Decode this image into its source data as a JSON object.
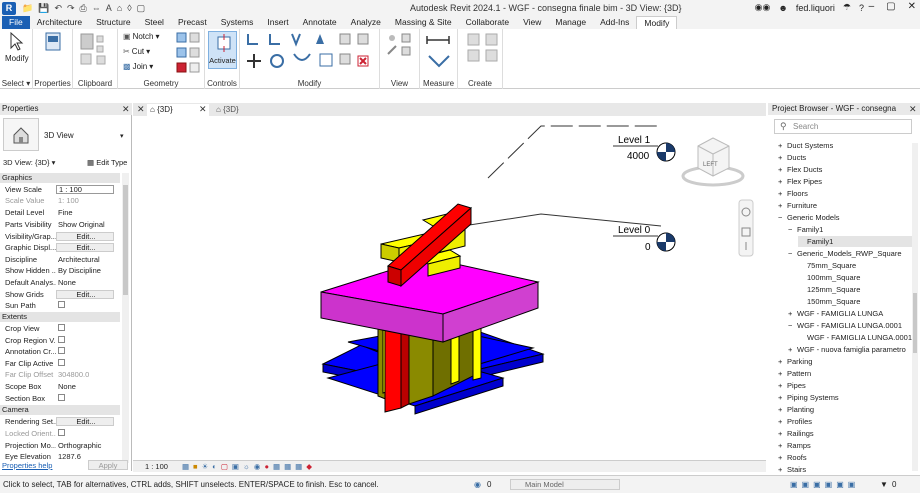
{
  "app": {
    "logo": "R",
    "title": "Autodesk Revit 2024.1 - WGF - consegna finale bim - 3D View: {3D}",
    "user": "fed.liquori"
  },
  "tabs": [
    "File",
    "Architecture",
    "Structure",
    "Steel",
    "Precast",
    "Systems",
    "Insert",
    "Annotate",
    "Analyze",
    "Massing & Site",
    "Collaborate",
    "View",
    "Manage",
    "Add-Ins",
    "Modify"
  ],
  "ribbon": {
    "select_label": "Modify",
    "select_panel": "Select",
    "properties_label": "Properties",
    "clipboard": "Clipboard",
    "notch": "Notch",
    "cut": "Cut",
    "join": "Join",
    "geometry": "Geometry",
    "activate": "Activate",
    "controls": "Controls",
    "modify": "Modify",
    "view": "View",
    "measure": "Measure",
    "create": "Create"
  },
  "properties": {
    "header": "Properties",
    "type_name": "3D View",
    "view_selector": "3D View: {3D}",
    "edit_type": "Edit Type",
    "help": "Properties help",
    "apply": "Apply",
    "groups": {
      "graphics": "Graphics",
      "extents": "Extents",
      "camera": "Camera"
    },
    "rows": {
      "view_scale": {
        "k": "View Scale",
        "v": "1 : 100"
      },
      "scale_value": {
        "k": "Scale Value",
        "v": "1:  100"
      },
      "detail_level": {
        "k": "Detail Level",
        "v": "Fine"
      },
      "parts_visibility": {
        "k": "Parts Visibility",
        "v": "Show Original"
      },
      "visibility": {
        "k": "Visibility/Grap...",
        "v": "Edit..."
      },
      "graphic_display": {
        "k": "Graphic Displ...",
        "v": "Edit..."
      },
      "discipline": {
        "k": "Discipline",
        "v": "Architectural"
      },
      "show_hidden": {
        "k": "Show Hidden ...",
        "v": "By Discipline"
      },
      "default_analysis": {
        "k": "Default Analys...",
        "v": "None"
      },
      "show_grids": {
        "k": "Show Grids",
        "v": "Edit..."
      },
      "sun_path": {
        "k": "Sun Path",
        "v": ""
      },
      "crop_view": {
        "k": "Crop View",
        "v": ""
      },
      "crop_region": {
        "k": "Crop Region V...",
        "v": ""
      },
      "annotation_crop": {
        "k": "Annotation Cr...",
        "v": ""
      },
      "far_clip_active": {
        "k": "Far Clip Active",
        "v": ""
      },
      "far_clip_offset": {
        "k": "Far Clip Offset",
        "v": "304800.0"
      },
      "scope_box": {
        "k": "Scope Box",
        "v": "None"
      },
      "section_box": {
        "k": "Section Box",
        "v": ""
      },
      "rendering": {
        "k": "Rendering Set...",
        "v": "Edit..."
      },
      "locked_orient": {
        "k": "Locked Orient...",
        "v": ""
      },
      "projection": {
        "k": "Projection Mo...",
        "v": "Orthographic"
      },
      "eye_elevation": {
        "k": "Eye Elevation",
        "v": "1287.6"
      }
    }
  },
  "view_tabs": [
    "{3D}",
    "{3D}"
  ],
  "viewport": {
    "scale": "1 : 100",
    "levels": [
      {
        "name": "Level 1",
        "elevation": "4000"
      },
      {
        "name": "Level 0",
        "elevation": "0"
      }
    ],
    "viewcube_label": "LEFT"
  },
  "browser": {
    "header": "Project Browser - WGF - consegna finale...",
    "search": "Search",
    "items": [
      {
        "label": "Duct Systems",
        "exp": "+"
      },
      {
        "label": "Ducts",
        "exp": "+"
      },
      {
        "label": "Flex Ducts",
        "exp": "+"
      },
      {
        "label": "Flex Pipes",
        "exp": "+"
      },
      {
        "label": "Floors",
        "exp": "+"
      },
      {
        "label": "Furniture",
        "exp": "+"
      },
      {
        "label": "Generic Models",
        "exp": "−"
      },
      {
        "label": "Family1",
        "exp": "−"
      },
      {
        "label": "Family1",
        "exp": ""
      },
      {
        "label": "Generic_Models_RWP_Square",
        "exp": "−"
      },
      {
        "label": "75mm_Square",
        "exp": ""
      },
      {
        "label": "100mm_Square",
        "exp": ""
      },
      {
        "label": "125mm_Square",
        "exp": ""
      },
      {
        "label": "150mm_Square",
        "exp": ""
      },
      {
        "label": "WGF - FAMIGLIA LUNGA",
        "exp": "+"
      },
      {
        "label": "WGF - FAMIGLIA LUNGA.0001",
        "exp": "−"
      },
      {
        "label": "WGF - FAMIGLIA LUNGA.0001",
        "exp": ""
      },
      {
        "label": "WGF - nuova famiglia parametro",
        "exp": "+"
      },
      {
        "label": "Parking",
        "exp": "+"
      },
      {
        "label": "Pattern",
        "exp": "+"
      },
      {
        "label": "Pipes",
        "exp": "+"
      },
      {
        "label": "Piping Systems",
        "exp": "+"
      },
      {
        "label": "Planting",
        "exp": "+"
      },
      {
        "label": "Profiles",
        "exp": "+"
      },
      {
        "label": "Railings",
        "exp": "+"
      },
      {
        "label": "Ramps",
        "exp": "+"
      },
      {
        "label": "Roofs",
        "exp": "+"
      },
      {
        "label": "Stairs",
        "exp": "+"
      }
    ]
  },
  "status": {
    "message": "Click to select, TAB for alternatives, CTRL adds, SHIFT unselects. ENTER/SPACE to finish. Esc to cancel.",
    "model": "Main Model",
    "count": "0"
  },
  "colors": {
    "magenta": "#ff00ff",
    "red": "#ff0000",
    "yellow": "#ffff00",
    "blue": "#0000ff",
    "olive": "#8a8a00",
    "accent": "#1a5fb4"
  }
}
